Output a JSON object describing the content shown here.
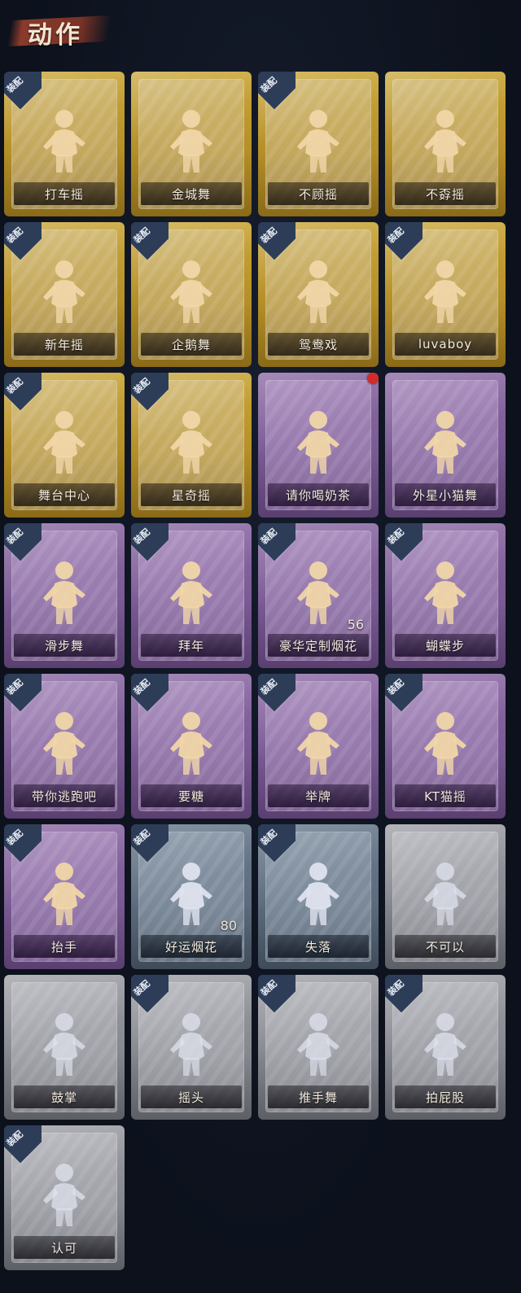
{
  "header": {
    "title": "动作"
  },
  "colors": {
    "gold": "#c9a63a",
    "purple": "#8c6aa4",
    "blue": "#6b7b8c",
    "gray": "#9b9ca2",
    "equip_badge": "#2d3d58",
    "new_dot": "#d22b2b"
  },
  "equip_label": "装配",
  "cards": [
    {
      "name": "打车摇",
      "rarity": "gold",
      "equipped": true,
      "icon": "dance-pose-icon"
    },
    {
      "name": "金城舞",
      "rarity": "gold",
      "equipped": false,
      "icon": "dance-pose-icon"
    },
    {
      "name": "不顾摇",
      "rarity": "gold",
      "equipped": true,
      "icon": "dance-pose-icon"
    },
    {
      "name": "不孬摇",
      "rarity": "gold",
      "equipped": false,
      "icon": "dance-pose-icon"
    },
    {
      "name": "新年摇",
      "rarity": "gold",
      "equipped": true,
      "icon": "dance-pose-icon"
    },
    {
      "name": "企鹅舞",
      "rarity": "gold",
      "equipped": true,
      "icon": "dance-pose-icon"
    },
    {
      "name": "鸳鸯戏",
      "rarity": "gold",
      "equipped": true,
      "icon": "dance-pose-icon"
    },
    {
      "name": "luvaboy",
      "rarity": "gold",
      "equipped": true,
      "icon": "dance-pose-icon"
    },
    {
      "name": "舞台中心",
      "rarity": "gold",
      "equipped": true,
      "icon": "dance-pose-icon"
    },
    {
      "name": "星奇摇",
      "rarity": "gold",
      "equipped": true,
      "icon": "dance-pose-icon"
    },
    {
      "name": "请你喝奶茶",
      "rarity": "purple",
      "equipped": false,
      "new": true,
      "icon": "milk-tea-sign-icon"
    },
    {
      "name": "外星小猫舞",
      "rarity": "purple",
      "equipped": false,
      "icon": "dance-pose-icon"
    },
    {
      "name": "滑步舞",
      "rarity": "purple",
      "equipped": true,
      "icon": "dance-pose-icon"
    },
    {
      "name": "拜年",
      "rarity": "purple",
      "equipped": true,
      "icon": "greeting-pose-icon"
    },
    {
      "name": "豪华定制烟花",
      "rarity": "purple",
      "equipped": true,
      "count": "56",
      "icon": "fireworks-box-icon"
    },
    {
      "name": "蝴蝶步",
      "rarity": "purple",
      "equipped": true,
      "icon": "dance-pose-icon"
    },
    {
      "name": "带你逃跑吧",
      "rarity": "purple",
      "equipped": true,
      "icon": "dance-pose-icon"
    },
    {
      "name": "要糖",
      "rarity": "purple",
      "equipped": true,
      "icon": "reach-out-icon"
    },
    {
      "name": "举牌",
      "rarity": "purple",
      "equipped": true,
      "icon": "hold-sign-icon"
    },
    {
      "name": "KT猫摇",
      "rarity": "purple",
      "equipped": true,
      "icon": "dance-pose-icon"
    },
    {
      "name": "抬手",
      "rarity": "purple",
      "equipped": true,
      "icon": "raise-hand-icon"
    },
    {
      "name": "好运烟花",
      "rarity": "blue",
      "equipped": true,
      "count": "80",
      "icon": "firework-can-icon"
    },
    {
      "name": "失落",
      "rarity": "blue",
      "equipped": true,
      "icon": "kneel-icon"
    },
    {
      "name": "不可以",
      "rarity": "gray",
      "equipped": false,
      "icon": "finger-wag-icon"
    },
    {
      "name": "鼓掌",
      "rarity": "gray",
      "equipped": false,
      "icon": "clap-icon"
    },
    {
      "name": "摇头",
      "rarity": "gray",
      "equipped": true,
      "icon": "shake-head-icon"
    },
    {
      "name": "推手舞",
      "rarity": "gray",
      "equipped": true,
      "icon": "push-hands-icon"
    },
    {
      "name": "拍屁股",
      "rarity": "gray",
      "equipped": true,
      "icon": "slap-icon"
    },
    {
      "name": "认可",
      "rarity": "gray",
      "equipped": true,
      "icon": "thumbs-up-icon"
    }
  ]
}
